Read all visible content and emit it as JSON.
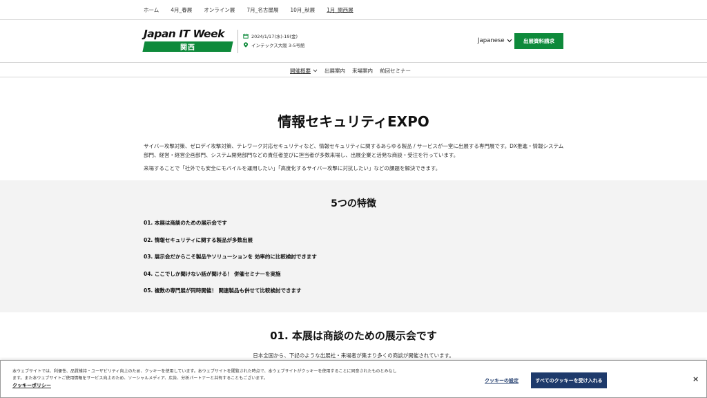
{
  "top_nav": {
    "items": [
      {
        "label": "ホーム"
      },
      {
        "label": "4月_春展"
      },
      {
        "label": "オンライン展"
      },
      {
        "label": "7月_名古屋展"
      },
      {
        "label": "10月_秋展"
      },
      {
        "label": "1月_関西展"
      }
    ]
  },
  "header": {
    "logo_top": "Japan IT Week",
    "logo_band": "関西",
    "date": "2024/1/17(水)-19(金)",
    "venue": "インテックス大阪 3-5号館",
    "language": "Japanese",
    "cta_label": "出展資料請求"
  },
  "sub_nav": {
    "items": [
      {
        "label": "開催概要"
      },
      {
        "label": "出展案内"
      },
      {
        "label": "来場案内"
      },
      {
        "label": "前回セミナー"
      }
    ]
  },
  "main": {
    "title": "情報セキュリティEXPO",
    "intro_1": "サイバー攻撃対策、ゼロデイ攻撃対策、テレワーク対応セキュリティなど、情報セキュリティに関するあらゆる製品 / サービスが一堂に出展する専門展です。DX推進・情報システム部門、経営・経営企画部門、システム開発部門などの責任者並びに担当者が多数来場し、出展企業と活発な商談・受注を行っています。",
    "intro_2": "来場することで「社外でも安全にモバイルを運用したい」「高度化するサイバー攻撃に対抗したい」などの課題を解決できます。"
  },
  "features": {
    "heading": "5つの特徴",
    "items": [
      "01. 本展は商談のための展示会です",
      "02. 情報セキュリティに関する製品が多数出展",
      "03. 展示会だからこそ製品やソリューションを 効率的に比較検討できます",
      "04. ここでしか聞けない話が聞ける！ 併催セミナーを実施",
      "05. 複数の専門展が同時開催！ 関連製品も併せて比較検討できます"
    ]
  },
  "section": {
    "title": "01. 本展は商談のための展示会です",
    "text": "日本全国から、下記のような出展社・来場者が集まり多くの商談が開催されています。"
  },
  "cookie": {
    "text": "本ウェブサイトでは、利便性、品質維持・ユーザビリティ向上のため、クッキーを使用しています。本ウェブサイトを閲覧された時点で、本ウェブサイトがクッキーを使用することに同意されたものとみなします。また本ウェブサイトご使用情報をサービス向上のため、ソーシャルメディア、広告、分析パートナーと共有することもございます。",
    "policy_link": "クッキーポリシー",
    "settings_label": "クッキーの設定",
    "accept_label": "すべてのクッキーを受け入れる",
    "close_label": "×"
  },
  "colors": {
    "brand_green": "#0e8a3b",
    "cookie_navy": "#1e3a6b",
    "features_bg": "#f3f3f3"
  }
}
